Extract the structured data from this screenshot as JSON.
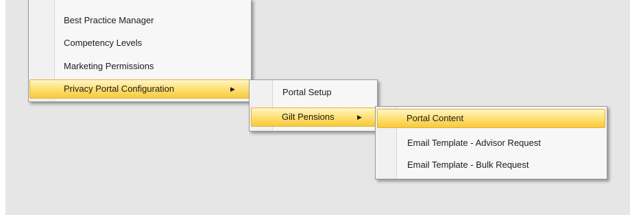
{
  "menu_level1": {
    "items": [
      {
        "label": "Best Practice Manager"
      },
      {
        "label": "Competency Levels"
      },
      {
        "label": "Marketing Permissions"
      },
      {
        "label": "Privacy Portal Configuration",
        "submenu_arrow": "▶"
      }
    ]
  },
  "menu_level2": {
    "items": [
      {
        "label": "Portal Setup"
      },
      {
        "label": "Gilt Pensions",
        "submenu_arrow": "▶"
      }
    ]
  },
  "menu_level3": {
    "items": [
      {
        "label": "Portal Content"
      },
      {
        "label": "Email Template - Advisor Request"
      },
      {
        "label": "Email Template - Bulk Request"
      }
    ]
  },
  "colors": {
    "highlight_top": "#fff6c8",
    "highlight_bottom": "#f8c93b",
    "highlight_border": "#e0b235",
    "menu_background": "#f7f7f7",
    "desktop_background": "#e6e6e6"
  }
}
